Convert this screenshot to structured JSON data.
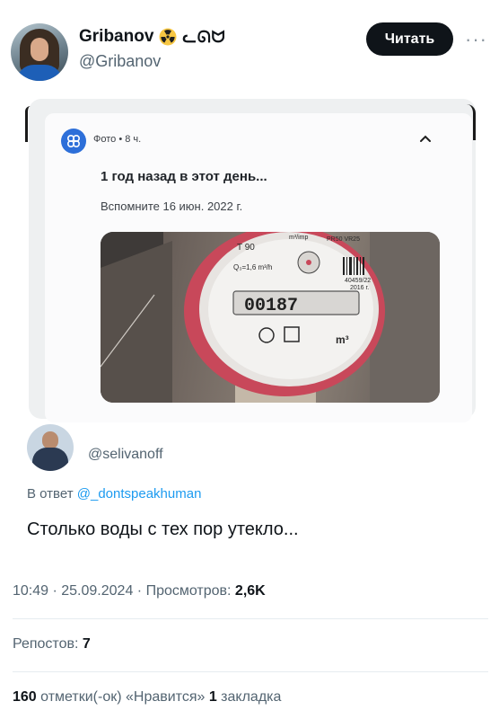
{
  "author": {
    "name": "Gribanov",
    "handle_glyph": "ᓚᘏᗢ",
    "handle": "@Gribanov",
    "follow_label": "Читать",
    "more_label": "···"
  },
  "card": {
    "meta": "Фото • 8 ч.",
    "title": "1 год назад в этот день...",
    "subtitle": "Вспомните 16 июн. 2022 г.",
    "photo": {
      "model": "T 90",
      "flow": "Q₃=1,6 m³/h",
      "mark": "PR50 VR25",
      "serial": "40459/22",
      "year": "2016 г.",
      "reading": "00187",
      "unit": "m³",
      "top_text": "m³/imp"
    }
  },
  "reply": {
    "handle": "@selivanoff",
    "context_prefix": "В ответ ",
    "mention": "@_dontspeakhuman",
    "text": "Столько воды с тех пор утекло..."
  },
  "meta": {
    "time": "10:49 · 25.09.2024 · ",
    "views_label": "Просмотров: ",
    "views": "2,6K",
    "reposts_label": "Репостов: ",
    "reposts": "7",
    "likes_count": "160",
    "likes_label": " отметки(-ок) «Нравится» ",
    "bookmarks_count": "1",
    "bookmarks_label": " закладка"
  },
  "colors": {
    "accent": "#1d9bf0",
    "button_bg": "#0f1419",
    "muted": "#536471",
    "radio_yellow": "#f7c744"
  }
}
